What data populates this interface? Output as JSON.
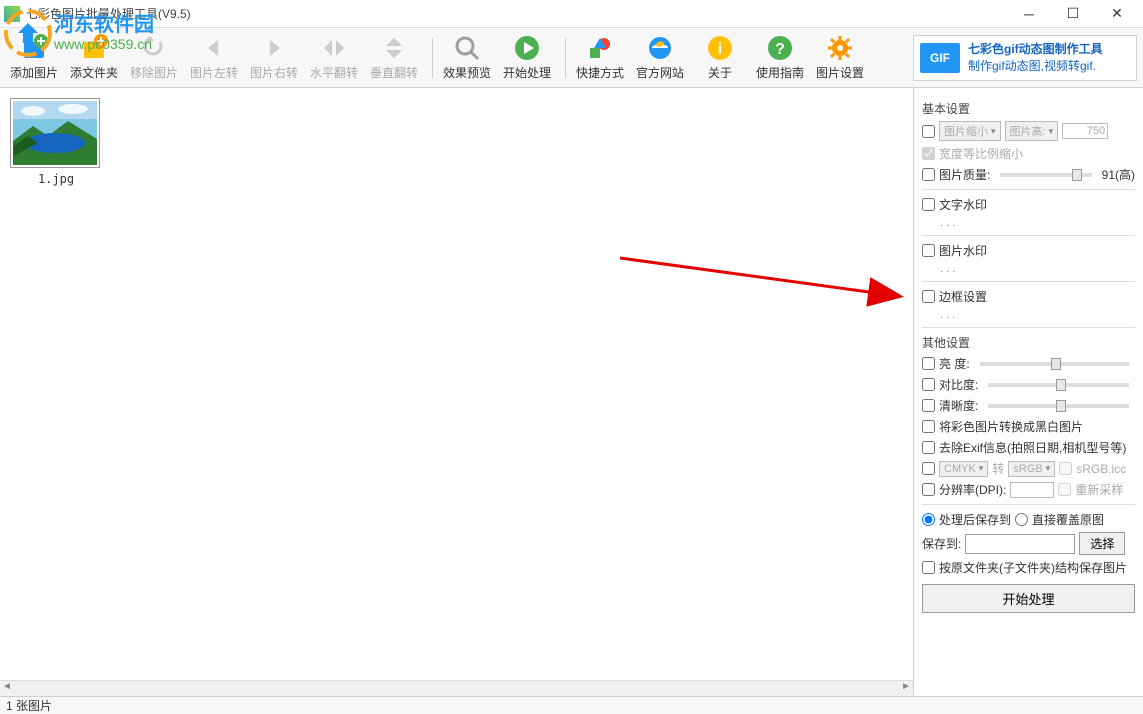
{
  "window": {
    "title": "七彩色图片批量处理工具(V9.5)"
  },
  "watermark": {
    "line1": "河东软件园",
    "line2": "www.pc0359.cn"
  },
  "toolbar": {
    "items": [
      {
        "label": "添加图片",
        "icon": "plus",
        "color": "#4caf50",
        "colorB": "#2196f3"
      },
      {
        "label": "添文件夹",
        "icon": "plus",
        "color": "#ff9800",
        "colorB": "#ffc107"
      },
      {
        "label": "移除图片",
        "icon": "undo",
        "disabled": true,
        "color": "#bbb"
      },
      {
        "label": "图片左转",
        "icon": "left",
        "disabled": true,
        "color": "#bbb"
      },
      {
        "label": "图片右转",
        "icon": "right",
        "disabled": true,
        "color": "#bbb"
      },
      {
        "label": "水平翻转",
        "icon": "hflip",
        "disabled": true,
        "color": "#bbb"
      },
      {
        "label": "垂直翻转",
        "icon": "vflip",
        "disabled": true,
        "color": "#bbb"
      },
      {
        "sep": true
      },
      {
        "label": "效果预览",
        "icon": "zoom",
        "color": "#9e9e9e"
      },
      {
        "label": "开始处理",
        "icon": "play",
        "color": "#4caf50"
      },
      {
        "sep": true
      },
      {
        "label": "快捷方式",
        "icon": "shapes",
        "color": "#f44336"
      },
      {
        "label": "官方网站",
        "icon": "ie",
        "color": "#2196f3"
      },
      {
        "label": "关于",
        "icon": "info",
        "color": "#ffc107"
      },
      {
        "label": "使用指南",
        "icon": "help",
        "color": "#4caf50"
      },
      {
        "label": "图片设置",
        "icon": "gear",
        "color": "#ff9800"
      }
    ]
  },
  "gifad": {
    "badge": "GIF",
    "line1": "七彩色gif动态图制作工具",
    "line2": "制作gif动态图,视频转gif."
  },
  "thumbnails": [
    {
      "name": "1.jpg"
    }
  ],
  "panel": {
    "basic_title": "基本设置",
    "shrink_label": "图片缩小",
    "height_label": "图片高:",
    "height_value": "750",
    "ratio_label": "宽度等比例缩小",
    "quality_label": "图片质量:",
    "quality_value": "91(高)",
    "text_wm": "文字水印",
    "image_wm": "图片水印",
    "border": "边框设置",
    "other_title": "其他设置",
    "brightness": "亮   度:",
    "contrast": "对比度:",
    "sharpness": "清晰度:",
    "bw": "将彩色图片转换成黑白图片",
    "exif": "去除Exif信息(拍照日期,相机型号等)",
    "cmyk_from": "CMYK",
    "cmyk_mid": "转",
    "cmyk_to": "sRGB",
    "icc": "sRGB.icc",
    "dpi_label": "分辨率(DPI):",
    "resample": "重新采样",
    "save_to_radio": "处理后保存到",
    "overwrite_radio": "直接覆盖原图",
    "save_to_label": "保存到:",
    "browse": "选择",
    "keep_structure": "按原文件夹(子文件夹)结构保存图片",
    "start_btn": "开始处理",
    "dots": ". . ."
  },
  "status": {
    "count": "1 张图片"
  }
}
